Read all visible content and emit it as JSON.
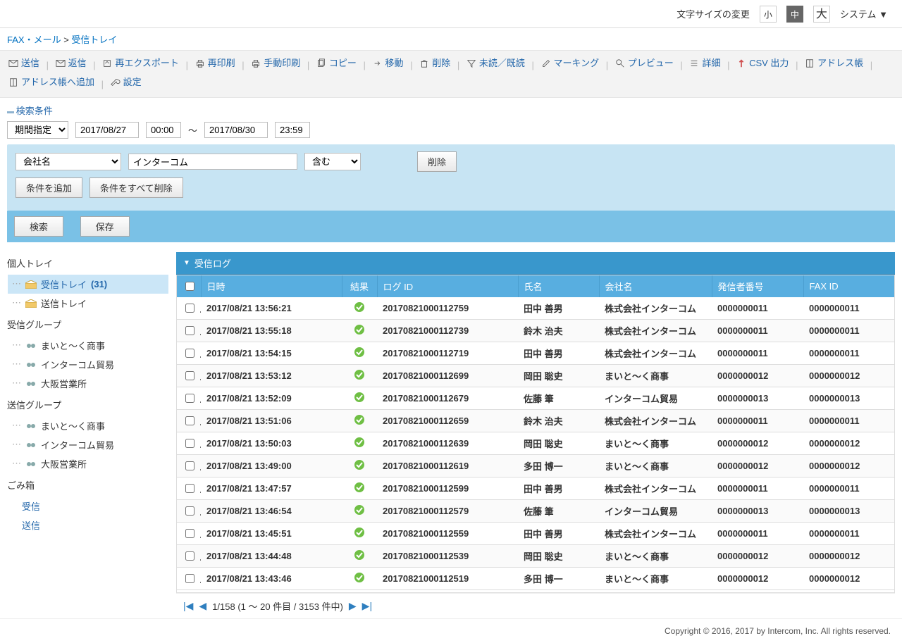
{
  "topbar": {
    "sizeLabel": "文字サイズの変更",
    "sizeSmall": "小",
    "sizeMedium": "中",
    "sizeLarge": "大",
    "systemLabel": "システム ▼"
  },
  "breadcrumb": {
    "root": "FAX・メール",
    "sep": " > ",
    "current": "受信トレイ"
  },
  "toolbar": {
    "send": "送信",
    "reply": "返信",
    "reexport": "再エクスポート",
    "reprint": "再印刷",
    "manualprint": "手動印刷",
    "copy": "コピー",
    "move": "移動",
    "delete": "削除",
    "readunread": "未読／既読",
    "marking": "マーキング",
    "preview": "プレビュー",
    "detail": "詳細",
    "csv": "CSV 出力",
    "addressbook": "アドレス帳",
    "addToAddressBook": "アドレス帳へ追加",
    "settings": "設定"
  },
  "search": {
    "title": "検索条件",
    "periodSpec": "期間指定",
    "dateFrom": "2017/08/27",
    "timeFrom": "00:00",
    "tilde": "～",
    "dateTo": "2017/08/30",
    "timeTo": "23:59",
    "field": "会社名",
    "value": "インターコム",
    "match": "含む",
    "deleteCond": "削除",
    "addCond": "条件を追加",
    "clearAll": "条件をすべて削除",
    "doSearch": "検索",
    "save": "保存"
  },
  "sidebar": {
    "personal": "個人トレイ",
    "inbox": "受信トレイ",
    "inboxCount": "(31)",
    "outbox": "送信トレイ",
    "recvGroup": "受信グループ",
    "sendGroup": "送信グループ",
    "grp1": "まいと～く商事",
    "grp2": "インターコム貿易",
    "grp3": "大阪営業所",
    "trash": "ごみ箱",
    "trashIn": "受信",
    "trashOut": "送信"
  },
  "table": {
    "title": "受信ログ",
    "col_chk": "",
    "col_dt": "日時",
    "col_res": "結果",
    "col_logid": "ログ ID",
    "col_name": "氏名",
    "col_company": "会社名",
    "col_caller": "発信者番号",
    "col_faxid": "FAX ID",
    "rows": [
      {
        "dt": "2017/08/21 13:56:21",
        "logid": "20170821000112759",
        "name": "田中 善男",
        "company": "株式会社インターコム",
        "caller": "0000000011",
        "faxid": "0000000011"
      },
      {
        "dt": "2017/08/21 13:55:18",
        "logid": "20170821000112739",
        "name": "鈴木 治夫",
        "company": "株式会社インターコム",
        "caller": "0000000011",
        "faxid": "0000000011"
      },
      {
        "dt": "2017/08/21 13:54:15",
        "logid": "20170821000112719",
        "name": "田中 善男",
        "company": "株式会社インターコム",
        "caller": "0000000011",
        "faxid": "0000000011"
      },
      {
        "dt": "2017/08/21 13:53:12",
        "logid": "20170821000112699",
        "name": "岡田 聡史",
        "company": "まいと～く商事",
        "caller": "0000000012",
        "faxid": "0000000012"
      },
      {
        "dt": "2017/08/21 13:52:09",
        "logid": "20170821000112679",
        "name": "佐藤 筆",
        "company": "インターコム貿易",
        "caller": "0000000013",
        "faxid": "0000000013"
      },
      {
        "dt": "2017/08/21 13:51:06",
        "logid": "20170821000112659",
        "name": "鈴木 治夫",
        "company": "株式会社インターコム",
        "caller": "0000000011",
        "faxid": "0000000011"
      },
      {
        "dt": "2017/08/21 13:50:03",
        "logid": "20170821000112639",
        "name": "岡田 聡史",
        "company": "まいと～く商事",
        "caller": "0000000012",
        "faxid": "0000000012"
      },
      {
        "dt": "2017/08/21 13:49:00",
        "logid": "20170821000112619",
        "name": "多田 博一",
        "company": "まいと～く商事",
        "caller": "0000000012",
        "faxid": "0000000012"
      },
      {
        "dt": "2017/08/21 13:47:57",
        "logid": "20170821000112599",
        "name": "田中 善男",
        "company": "株式会社インターコム",
        "caller": "0000000011",
        "faxid": "0000000011"
      },
      {
        "dt": "2017/08/21 13:46:54",
        "logid": "20170821000112579",
        "name": "佐藤 筆",
        "company": "インターコム貿易",
        "caller": "0000000013",
        "faxid": "0000000013"
      },
      {
        "dt": "2017/08/21 13:45:51",
        "logid": "20170821000112559",
        "name": "田中 善男",
        "company": "株式会社インターコム",
        "caller": "0000000011",
        "faxid": "0000000011"
      },
      {
        "dt": "2017/08/21 13:44:48",
        "logid": "20170821000112539",
        "name": "岡田 聡史",
        "company": "まいと～く商事",
        "caller": "0000000012",
        "faxid": "0000000012"
      },
      {
        "dt": "2017/08/21 13:43:46",
        "logid": "20170821000112519",
        "name": "多田 博一",
        "company": "まいと～く商事",
        "caller": "0000000012",
        "faxid": "0000000012"
      }
    ]
  },
  "pager": {
    "text": "1/158 (1 ～ 20 件目 / 3153 件中)"
  },
  "footer": {
    "copyright": "Copyright © 2016, 2017 by Intercom, Inc. All rights reserved."
  }
}
